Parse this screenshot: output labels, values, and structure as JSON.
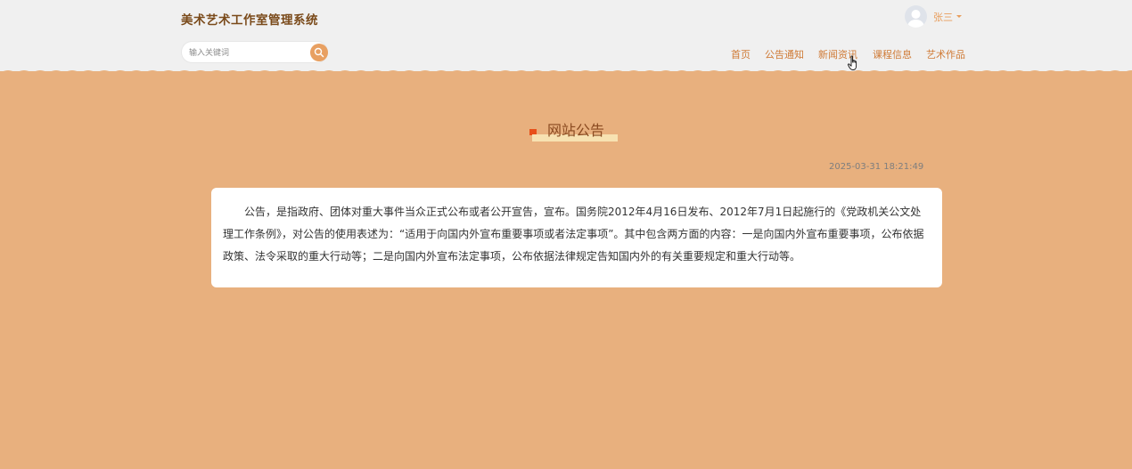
{
  "header": {
    "site_title": "美术艺术工作室管理系统",
    "search": {
      "placeholder": "输入关键词",
      "value": "",
      "icon": "search-icon"
    },
    "user": {
      "name": "张三",
      "avatar_icon": "avatar-icon"
    },
    "nav": [
      {
        "label": "首页"
      },
      {
        "label": "公告通知"
      },
      {
        "label": "新闻资讯"
      },
      {
        "label": "课程信息"
      },
      {
        "label": "艺术作品"
      }
    ]
  },
  "main": {
    "section_title": "网站公告",
    "date": "2025-03-31 18:21:49",
    "content": "公告，是指政府、团体对重大事件当众正式公布或者公开宣告，宣布。国务院2012年4月16日发布、2012年7月1日起施行的《党政机关公文处理工作条例》，对公告的使用表述为：“适用于向国内外宣布重要事项或者法定事项”。其中包含两方面的内容：一是向国内外宣布重要事项，公布依据政策、法令采取的重大行动等；二是向国内外宣布法定事项，公布依据法律规定告知国内外的有关重要规定和重大行动等。"
  },
  "colors": {
    "background": "#e8b07e",
    "header_bg": "#f0f0f0",
    "accent": "#e8a062",
    "nav_text": "#cf7a35",
    "title_flag": "#e8501a"
  }
}
